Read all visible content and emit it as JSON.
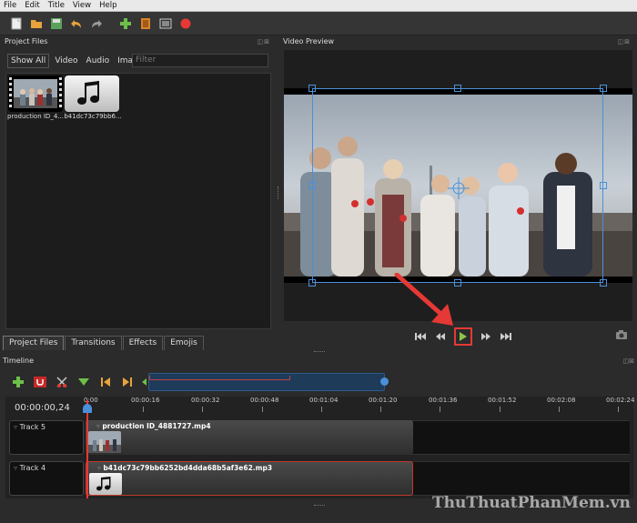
{
  "menu": [
    "File",
    "Edit",
    "Title",
    "View",
    "Help"
  ],
  "toolbar_icons": [
    "new-project-icon",
    "open-project-icon",
    "save-project-icon",
    "undo-icon",
    "redo-icon",
    "import-files-icon",
    "choose-profile-icon",
    "fullscreen-icon",
    "export-video-icon"
  ],
  "panels": {
    "project_files_title": "Project Files",
    "video_preview_title": "Video Preview",
    "timeline_title": "Timeline",
    "panel_buttons": "◫⊠"
  },
  "filter": {
    "buttons": [
      "Show All",
      "Video",
      "Audio",
      "Image"
    ],
    "placeholder": "Filter"
  },
  "files": [
    {
      "name": "production ID_4...",
      "type": "video"
    },
    {
      "name": "b41dc73c79bb6...",
      "type": "audio"
    }
  ],
  "tabs": [
    "Project Files",
    "Transitions",
    "Effects",
    "Emojis"
  ],
  "timeline": {
    "timecode": "00:00:00,24",
    "ticks": [
      "0:00",
      "00:00:16",
      "00:00:32",
      "00:00:48",
      "00:01:04",
      "00:01:20",
      "00:01:36",
      "00:01:52",
      "00:02:08",
      "00:02:24"
    ],
    "tracks": [
      {
        "label": "Track 5",
        "clip": "production ID_4881727.mp4",
        "kind": "video"
      },
      {
        "label": "Track 4",
        "clip": "b41dc73c79bb6252bd4dda68b5af3e62.mp3",
        "kind": "audio"
      }
    ]
  },
  "watermark": "ThuThuatPhanMem.vn",
  "colors": {
    "accent_blue": "#4a90d9",
    "highlight_red": "#e53935",
    "play_green": "#8bc34a"
  }
}
